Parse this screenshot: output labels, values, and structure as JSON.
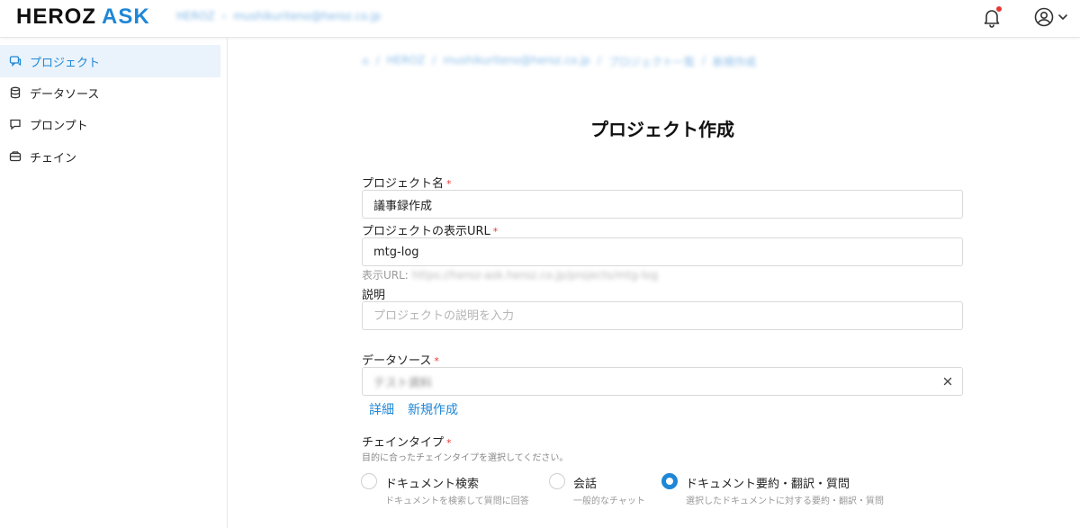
{
  "header": {
    "logo_heroz": "HEROZ",
    "logo_ask": "ASK",
    "tenant": "HEROZ",
    "tenant_user": "mushikuriteno@heroz.co.jp"
  },
  "sidebar": {
    "items": [
      {
        "label": "プロジェクト",
        "icon": "project-icon",
        "active": true
      },
      {
        "label": "データソース",
        "icon": "database-icon",
        "active": false
      },
      {
        "label": "プロンプト",
        "icon": "prompt-icon",
        "active": false
      },
      {
        "label": "チェイン",
        "icon": "chain-icon",
        "active": false
      }
    ]
  },
  "breadcrumb": [
    "HEROZ",
    "mushikuriteno@heroz.co.jp",
    "プロジェクト一覧",
    "新規作成"
  ],
  "page": {
    "title": "プロジェクト作成"
  },
  "form": {
    "name": {
      "label": "プロジェクト名",
      "required_mark": "*",
      "value": "議事録作成"
    },
    "url": {
      "label": "プロジェクトの表示URL",
      "required_mark": "*",
      "value": "mtg-log",
      "preview_label": "表示URL:",
      "preview_value": "https://heroz-ask.heroz.co.jp/projects/mtg-log"
    },
    "description": {
      "label": "説明",
      "placeholder": "プロジェクトの説明を入力"
    },
    "datasource": {
      "label": "データソース",
      "required_mark": "*",
      "value": "テスト資料",
      "link_detail": "詳細",
      "link_new": "新規作成"
    },
    "chain_type": {
      "label": "チェインタイプ",
      "required_mark": "*",
      "helper": "目的に合ったチェインタイプを選択してください。",
      "options": [
        {
          "title": "ドキュメント検索",
          "desc": "ドキュメントを検索して質問に回答",
          "checked": false
        },
        {
          "title": "会話",
          "desc": "一般的なチャット",
          "checked": false
        },
        {
          "title": "ドキュメント要約・翻訳・質問",
          "desc": "選択したドキュメントに対する要約・翻訳・質問",
          "checked": true
        }
      ]
    }
  },
  "colors": {
    "accent": "#1f87d6",
    "required": "#e53935",
    "active_bg": "#eaf3fb"
  }
}
